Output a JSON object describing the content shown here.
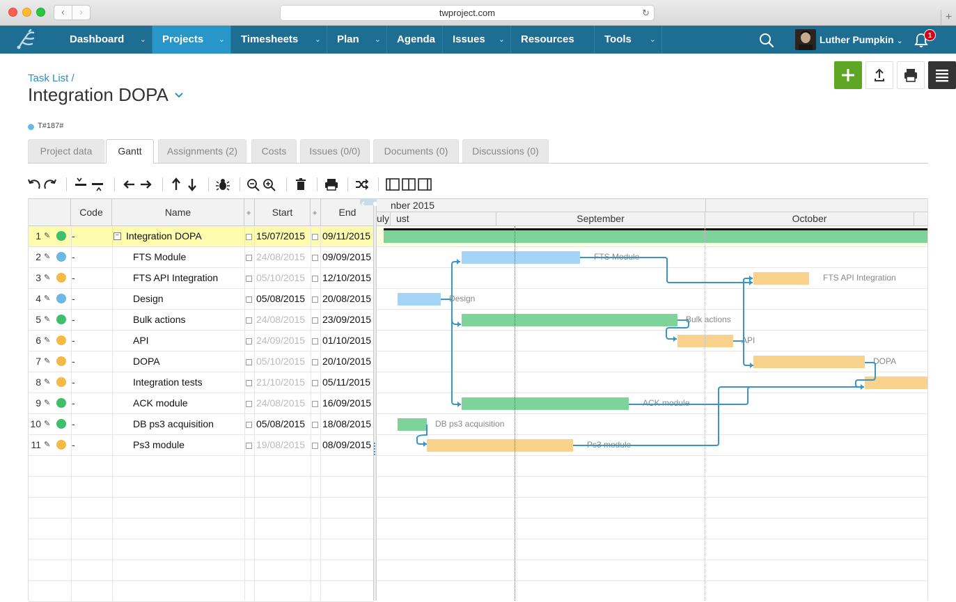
{
  "browser": {
    "url": "twproject.com",
    "back_glyph": "‹",
    "fwd_glyph": "›",
    "reload_glyph": "↻",
    "newtab_glyph": "+"
  },
  "nav": {
    "items": [
      {
        "label": "Dashboard",
        "chevron": "⌄",
        "active": false
      },
      {
        "label": "Projects",
        "chevron": "⌄",
        "active": true
      },
      {
        "label": "Timesheets",
        "chevron": "⌄",
        "active": false
      },
      {
        "label": "Plan",
        "chevron": "⌄",
        "active": false
      },
      {
        "label": "Agenda",
        "chevron": "",
        "active": false
      },
      {
        "label": "Issues",
        "chevron": "⌄",
        "active": false
      },
      {
        "label": "Resources",
        "chevron": "",
        "active": false
      },
      {
        "label": "Tools",
        "chevron": "⌄",
        "active": false
      }
    ],
    "user_name": "Luther Pumpkin",
    "user_chevron": "⌄",
    "notification_count": "1",
    "colors": {
      "bar": "#1e6e94",
      "active": "#2896c9"
    }
  },
  "header": {
    "breadcrumb": "Task List /",
    "title": "Integration DOPA",
    "code": "T#187#"
  },
  "tabs": [
    {
      "label": "Project data",
      "active": false
    },
    {
      "label": "Gantt",
      "active": true
    },
    {
      "label": "Assignments (2)",
      "active": false
    },
    {
      "label": "Costs",
      "active": false
    },
    {
      "label": "Issues (0/0)",
      "active": false
    },
    {
      "label": "Documents (0)",
      "active": false
    },
    {
      "label": "Discussions (0)",
      "active": false
    }
  ],
  "grid": {
    "columns": {
      "code": "Code",
      "name": "Name",
      "start": "Start",
      "end": "End"
    },
    "sort_glyph": "◈",
    "edit_glyph": "✎",
    "collapse_glyph": "−",
    "rows": [
      {
        "num": "1",
        "status": "green",
        "code": "-",
        "name": "Integration DOPA",
        "start": "15/07/2015",
        "start_dim": false,
        "end": "09/11/2015",
        "level": 0,
        "selected": true
      },
      {
        "num": "2",
        "status": "blue",
        "code": "-",
        "name": "FTS Module",
        "start": "24/08/2015",
        "start_dim": true,
        "end": "09/09/2015",
        "level": 1,
        "selected": false
      },
      {
        "num": "3",
        "status": "orange",
        "code": "-",
        "name": "FTS API Integration",
        "start": "05/10/2015",
        "start_dim": true,
        "end": "12/10/2015",
        "level": 1,
        "selected": false
      },
      {
        "num": "4",
        "status": "blue",
        "code": "-",
        "name": "Design",
        "start": "05/08/2015",
        "start_dim": false,
        "end": "20/08/2015",
        "level": 1,
        "selected": false
      },
      {
        "num": "5",
        "status": "green",
        "code": "-",
        "name": "Bulk actions",
        "start": "24/08/2015",
        "start_dim": true,
        "end": "23/09/2015",
        "level": 1,
        "selected": false
      },
      {
        "num": "6",
        "status": "orange",
        "code": "-",
        "name": "API",
        "start": "24/09/2015",
        "start_dim": true,
        "end": "01/10/2015",
        "level": 1,
        "selected": false
      },
      {
        "num": "7",
        "status": "orange",
        "code": "-",
        "name": "DOPA",
        "start": "05/10/2015",
        "start_dim": true,
        "end": "20/10/2015",
        "level": 1,
        "selected": false
      },
      {
        "num": "8",
        "status": "orange",
        "code": "-",
        "name": "Integration tests",
        "start": "21/10/2015",
        "start_dim": true,
        "end": "05/11/2015",
        "level": 1,
        "selected": false
      },
      {
        "num": "9",
        "status": "green",
        "code": "-",
        "name": "ACK module",
        "start": "24/08/2015",
        "start_dim": true,
        "end": "16/09/2015",
        "level": 1,
        "selected": false
      },
      {
        "num": "10",
        "status": "green",
        "code": "-",
        "name": "DB ps3 acquisition",
        "start": "05/08/2015",
        "start_dim": false,
        "end": "18/08/2015",
        "level": 1,
        "selected": false
      },
      {
        "num": "11",
        "status": "orange",
        "code": "-",
        "name": "Ps3 module",
        "start": "19/08/2015",
        "start_dim": true,
        "end": "08/09/2015",
        "level": 1,
        "selected": false
      }
    ],
    "status_colors": {
      "green": "#3fbf6a",
      "blue": "#6bb7e8",
      "orange": "#f7b946"
    }
  },
  "gantt": {
    "header_top": "nber 2015",
    "header_months": [
      "July",
      "ust",
      "September",
      "October"
    ],
    "bars": [
      {
        "label": "",
        "color": "green"
      },
      {
        "label": "FTS Module",
        "color": "blue"
      },
      {
        "label": "FTS API Integration",
        "color": "orange"
      },
      {
        "label": "Design",
        "color": "blue"
      },
      {
        "label": "Bulk actions",
        "color": "green"
      },
      {
        "label": "API",
        "color": "orange"
      },
      {
        "label": "DOPA",
        "color": "orange"
      },
      {
        "label": "",
        "color": "orange"
      },
      {
        "label": "ACK module",
        "color": "green"
      },
      {
        "label": "DB ps3 acquisition",
        "color": "green"
      },
      {
        "label": "Ps3 module",
        "color": "orange"
      }
    ]
  }
}
